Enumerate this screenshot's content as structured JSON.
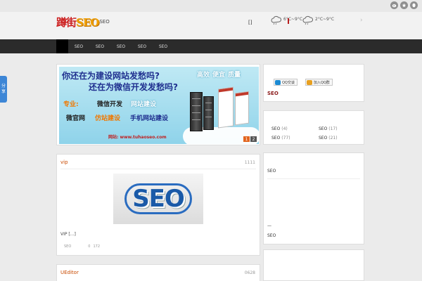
{
  "colors": {
    "nav_bg": "#2b2b2b",
    "accent_orange": "#c94a00",
    "logo_red": "#cc1f1f",
    "logo_gold": "#f0a000",
    "share_blue": "#3d86d6"
  },
  "top_icons": [
    "weibo-icon",
    "qzone-icon",
    "qq-icon"
  ],
  "header": {
    "logo_part1": "蹲街",
    "logo_part2": "SEO",
    "logo_suffix": "SEO",
    "bracket": "[]",
    "weather1": "6°C~9°C",
    "weather2": "2°C~9°C",
    "next_arrow": "›"
  },
  "nav": {
    "items": [
      "SEO",
      "SEO",
      "SEO",
      "SEO",
      "SEO"
    ]
  },
  "banner": {
    "line1": "你还在为建设网站发愁吗?",
    "line2": "还在为微信开发发愁吗?",
    "tags": [
      "高效",
      "便宜",
      "质量"
    ],
    "professional": "专业:",
    "row1": [
      {
        "text": "微信开发",
        "color": "#222"
      },
      {
        "text": "网站建设",
        "color": "#ffffff"
      }
    ],
    "row2": [
      {
        "text": "微官网",
        "color": "#222"
      },
      {
        "text": "仿站建设",
        "color": "#f07800"
      },
      {
        "text": "手机网站建设",
        "color": "#1f2f8f"
      }
    ],
    "url": "网站: www.tuhaoseo.com",
    "pager": [
      "1",
      "2"
    ]
  },
  "post": {
    "title": "vip",
    "count": "1111",
    "image_text": "SEO",
    "excerpt": "VIP  [...]",
    "meta_cat": "SEO",
    "meta_comments": "0",
    "meta_views": "172"
  },
  "post2": {
    "title": "UEditor",
    "count": "0628"
  },
  "sidebar": {
    "qq_chat": "QQ交谈",
    "qq_group": "加入QQ群",
    "seo_title": "SEO",
    "categories": [
      {
        "name": "SEO",
        "count": "(4)"
      },
      {
        "name": "SEO",
        "count": "(17)"
      },
      {
        "name": "SEO",
        "count": "(77)"
      },
      {
        "name": "SEO",
        "count": "(21)"
      }
    ],
    "list_top": "SEO",
    "dash": "—",
    "list_bottom": "SEO"
  },
  "share": {
    "line1": "分",
    "line2": "享"
  }
}
